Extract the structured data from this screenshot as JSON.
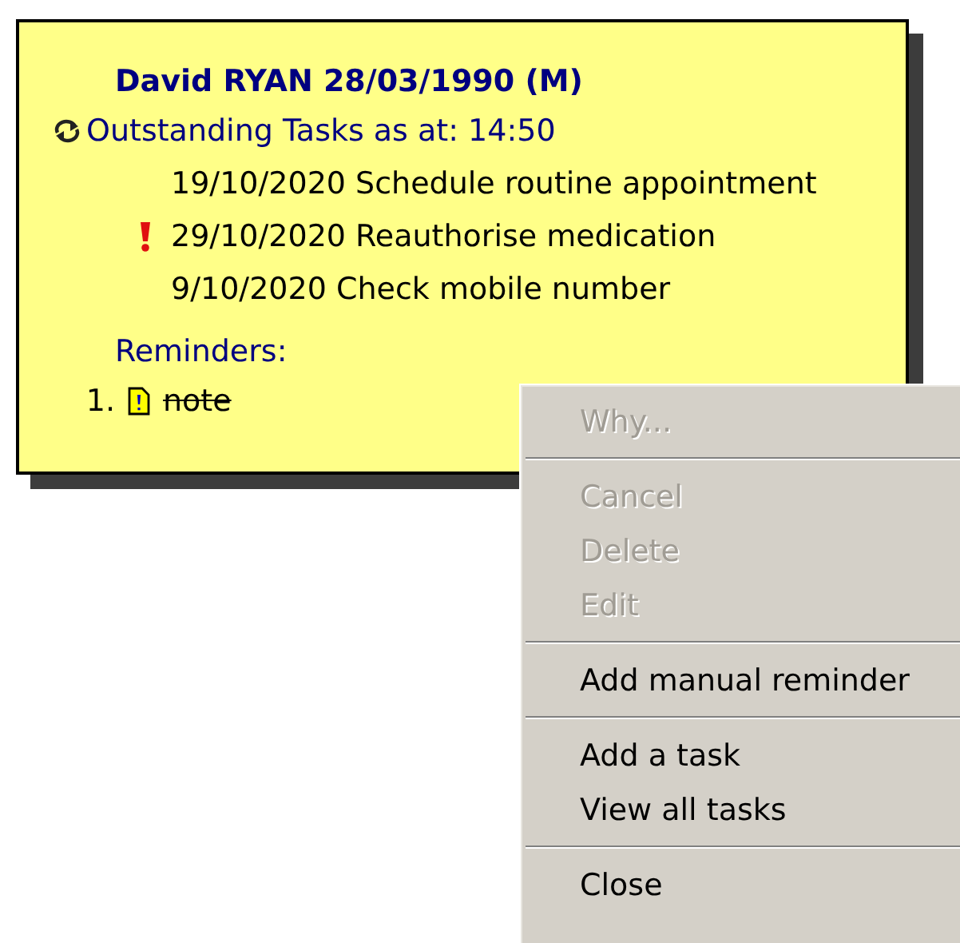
{
  "patient": {
    "title": "David RYAN 28/03/1990 (M)"
  },
  "tasks": {
    "heading": "Outstanding Tasks as at: 14:50",
    "items": [
      {
        "text": "19/10/2020 Schedule routine appointment",
        "urgent": false
      },
      {
        "text": "29/10/2020 Reauthorise medication",
        "urgent": true
      },
      {
        "text": "9/10/2020 Check mobile number",
        "urgent": false
      }
    ]
  },
  "reminders": {
    "heading": "Reminders:",
    "items": [
      {
        "number": "1.",
        "text": "note",
        "struck": true
      }
    ]
  },
  "context_menu": [
    {
      "kind": "item",
      "label": "Why...",
      "disabled": true
    },
    {
      "kind": "separator"
    },
    {
      "kind": "item",
      "label": "Cancel",
      "disabled": true
    },
    {
      "kind": "item",
      "label": "Delete",
      "disabled": true
    },
    {
      "kind": "item",
      "label": "Edit",
      "disabled": true
    },
    {
      "kind": "separator"
    },
    {
      "kind": "item",
      "label": "Add manual reminder",
      "disabled": false
    },
    {
      "kind": "separator"
    },
    {
      "kind": "item",
      "label": "Add a task",
      "disabled": false
    },
    {
      "kind": "item",
      "label": "View all tasks",
      "disabled": false
    },
    {
      "kind": "separator"
    },
    {
      "kind": "item",
      "label": "Close",
      "disabled": false
    }
  ]
}
